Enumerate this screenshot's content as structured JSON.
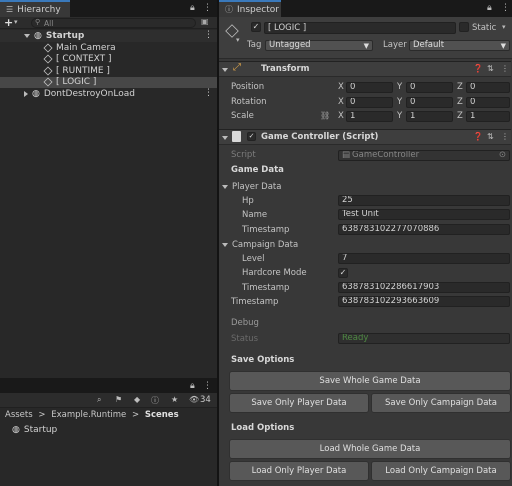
{
  "hierarchy": {
    "tab_label": "Hierarchy",
    "search_placeholder": "All",
    "add_label": "+",
    "items": [
      {
        "label": "Startup"
      },
      {
        "label": "Main Camera"
      },
      {
        "label": "[ CONTEXT ]"
      },
      {
        "label": "[ RUNTIME ]"
      },
      {
        "label": "[ LOGIC ]"
      },
      {
        "label": "DontDestroyOnLoad"
      }
    ]
  },
  "project": {
    "breadcrumb": [
      "Assets",
      "Example.Runtime",
      "Scenes"
    ],
    "sep": ">",
    "hidden_count": "34",
    "items": [
      {
        "label": "Startup"
      }
    ]
  },
  "inspector": {
    "tab_label": "Inspector",
    "object_name": "[ LOGIC ]",
    "static_label": "Static",
    "tag_label": "Tag",
    "tag_value": "Untagged",
    "layer_label": "Layer",
    "layer_value": "Default",
    "transform": {
      "title": "Transform",
      "rows": [
        {
          "label": "Position",
          "x": "0",
          "y": "0",
          "z": "0"
        },
        {
          "label": "Rotation",
          "x": "0",
          "y": "0",
          "z": "0"
        },
        {
          "label": "Scale",
          "x": "1",
          "y": "1",
          "z": "1"
        }
      ],
      "axis": {
        "x": "X",
        "y": "Y",
        "z": "Z"
      }
    },
    "component": {
      "title": "Game Controller (Script)",
      "script_label": "Script",
      "script_value": "GameController",
      "game_data_label": "Game Data",
      "player_data_label": "Player Data",
      "hp_label": "Hp",
      "hp_value": "25",
      "name_label": "Name",
      "name_value": "Test Unit",
      "timestamp_label": "Timestamp",
      "player_timestamp": "638783102277070886",
      "campaign_data_label": "Campaign Data",
      "level_label": "Level",
      "level_value": "7",
      "hardcore_label": "Hardcore Mode",
      "hardcore_value": "✓",
      "campaign_timestamp": "638783102286617903",
      "game_timestamp": "638783102293663609",
      "debug_label": "Debug",
      "status_label": "Status",
      "status_value": "Ready",
      "save_options_label": "Save Options",
      "save_whole": "Save Whole Game Data",
      "save_player": "Save Only Player Data",
      "save_campaign": "Save Only Campaign Data",
      "load_options_label": "Load Options",
      "load_whole": "Load Whole Game Data",
      "load_player": "Load Only Player Data",
      "load_campaign": "Load Only Campaign Data"
    }
  },
  "colors": {
    "accent_blue": "#2c5d87",
    "status_green": "#4f8a43",
    "button_gray": "#585858"
  }
}
